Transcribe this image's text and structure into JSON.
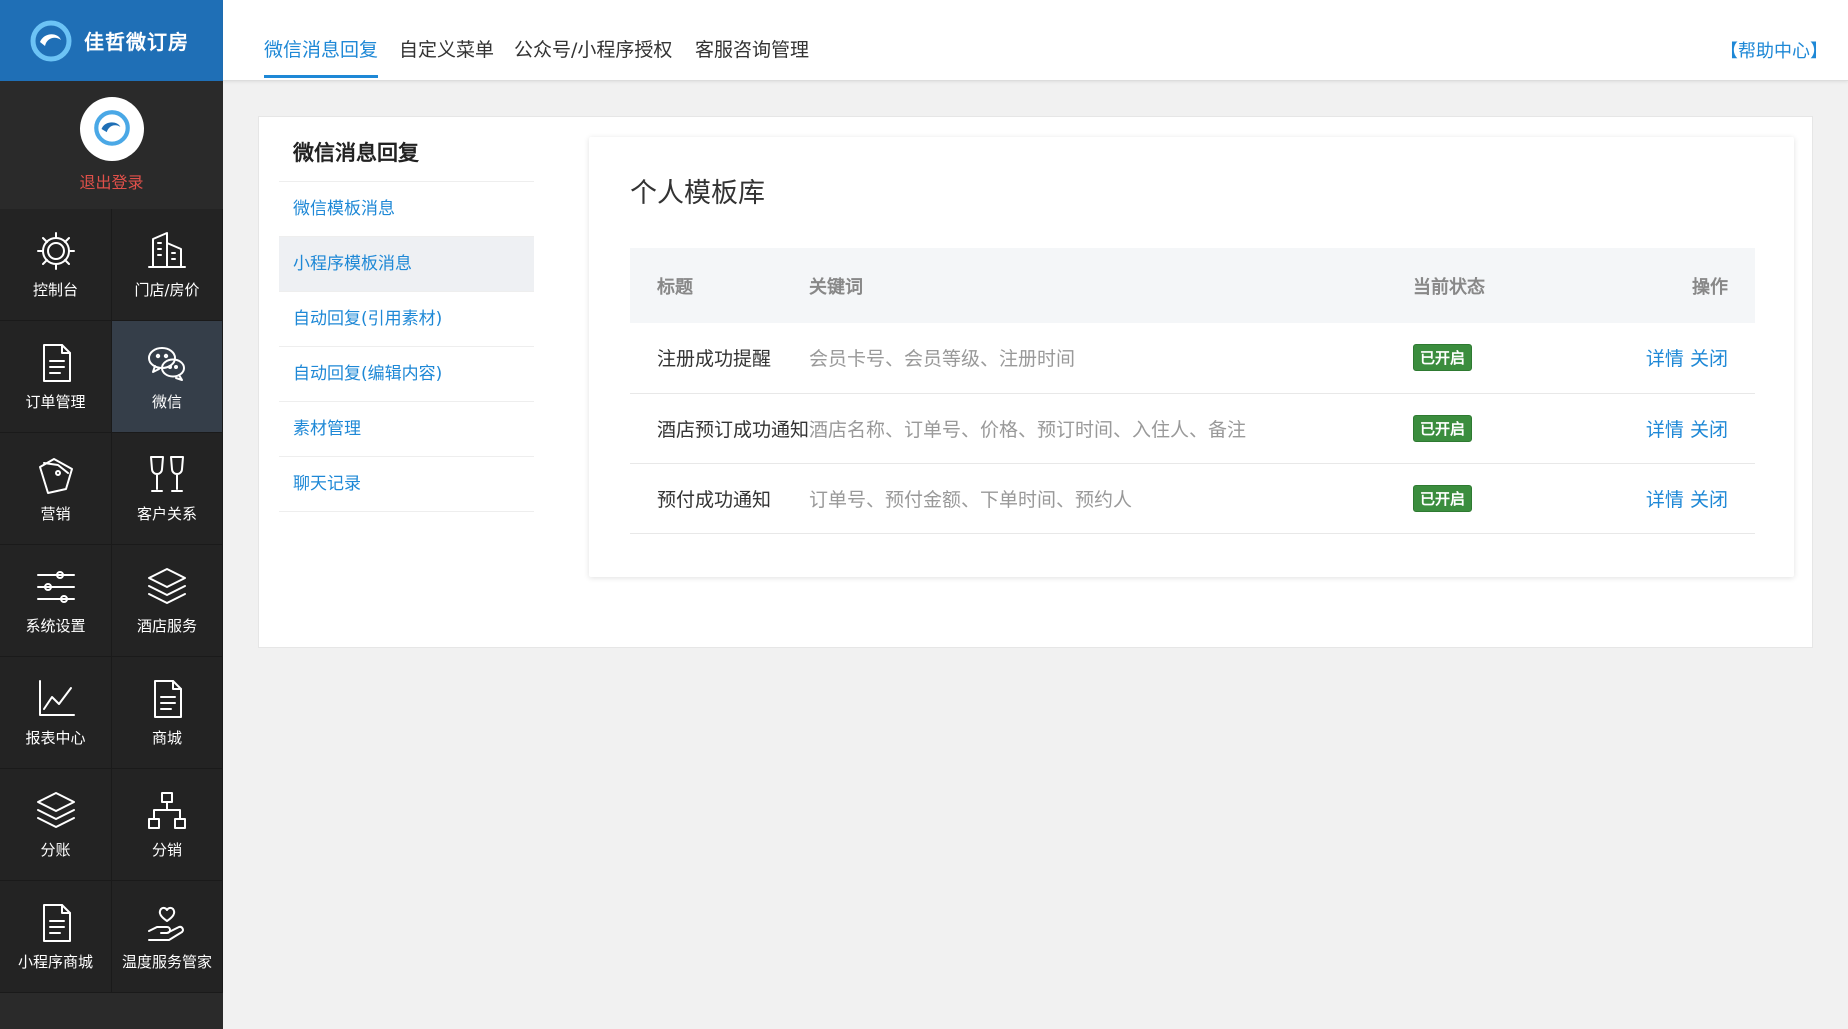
{
  "app": {
    "brand": "佳哲微订房",
    "logout_label": "退出登录"
  },
  "sidebar": {
    "items": [
      {
        "label": "控制台",
        "icon": "gear-icon"
      },
      {
        "label": "门店/房价",
        "icon": "building-icon"
      },
      {
        "label": "订单管理",
        "icon": "document-icon"
      },
      {
        "label": "微信",
        "icon": "wechat-icon"
      },
      {
        "label": "营销",
        "icon": "tags-icon"
      },
      {
        "label": "客户关系",
        "icon": "wine-glasses-icon"
      },
      {
        "label": "系统设置",
        "icon": "sliders-icon"
      },
      {
        "label": "酒店服务",
        "icon": "layers-icon"
      },
      {
        "label": "报表中心",
        "icon": "line-chart-icon"
      },
      {
        "label": "商城",
        "icon": "document-icon"
      },
      {
        "label": "分账",
        "icon": "layers-icon"
      },
      {
        "label": "分销",
        "icon": "org-chart-icon"
      },
      {
        "label": "小程序商城",
        "icon": "document-icon"
      },
      {
        "label": "温度服务管家",
        "icon": "heart-hand-icon"
      }
    ]
  },
  "topbar": {
    "tabs": [
      {
        "label": "微信消息回复"
      },
      {
        "label": "自定义菜单"
      },
      {
        "label": "公众号/小程序授权"
      },
      {
        "label": "客服咨询管理"
      }
    ],
    "help_label": "【帮助中心】"
  },
  "subnav": {
    "heading": "微信消息回复",
    "items": [
      {
        "label": "微信模板消息"
      },
      {
        "label": "小程序模板消息"
      },
      {
        "label": "自动回复(引用素材)"
      },
      {
        "label": "自动回复(编辑内容)"
      },
      {
        "label": "素材管理"
      },
      {
        "label": "聊天记录"
      }
    ]
  },
  "panel": {
    "title": "个人模板库",
    "columns": {
      "title": "标题",
      "keywords": "关键词",
      "status": "当前状态",
      "actions": "操作"
    },
    "rows": [
      {
        "title": "注册成功提醒",
        "keywords": "会员卡号、会员等级、注册时间",
        "status": "已开启",
        "detail": "详情",
        "close": "关闭"
      },
      {
        "title": "酒店预订成功通知",
        "keywords": "酒店名称、订单号、价格、预订时间、入住人、备注",
        "status": "已开启",
        "detail": "详情",
        "close": "关闭"
      },
      {
        "title": "预付成功通知",
        "keywords": "订单号、预付金额、下单时间、预约人",
        "status": "已开启",
        "detail": "详情",
        "close": "关闭"
      }
    ]
  },
  "colors": {
    "accent": "#1e88d6",
    "sidebar_bg": "#2a2a2a",
    "logo_bg": "#1f6fb6",
    "status_green": "#3b8d3e",
    "logout_red": "#e0504a"
  }
}
